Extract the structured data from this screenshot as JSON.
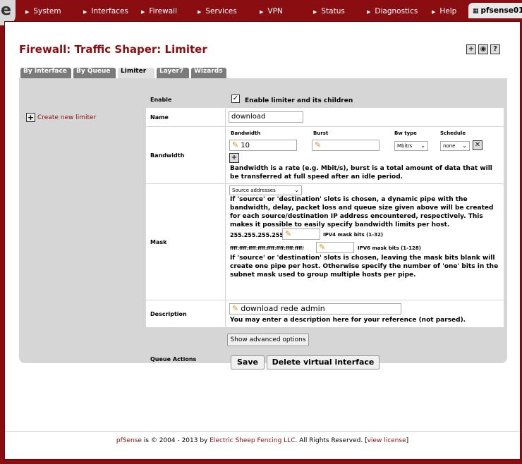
{
  "nav": {
    "logo": "e",
    "items": [
      "System",
      "Interfaces",
      "Firewall",
      "Services",
      "VPN",
      "Status",
      "Diagnostics",
      "Help"
    ],
    "hostname": "pfsense01"
  },
  "page": {
    "title": "Firewall: Traffic Shaper: Limiter",
    "tabs": [
      "By Interface",
      "By Queue",
      "Limiter",
      "Layer7",
      "Wizards"
    ],
    "active_tab": "Limiter",
    "create_link": "Create new limiter"
  },
  "form": {
    "enable": {
      "label": "Enable",
      "checkbox_label": "Enable limiter and its children",
      "checked": true
    },
    "name": {
      "label": "Name",
      "value": "download"
    },
    "bandwidth": {
      "label": "Bandwidth",
      "col_bandwidth": "Bandwidth",
      "col_burst": "Burst",
      "col_bwtype": "Bw type",
      "col_schedule": "Schedule",
      "bandwidth_value": "10",
      "burst_value": "",
      "bwtype_value": "Mbit/s",
      "schedule_value": "none",
      "help": "Bandwidth is a rate (e.g. Mbit/s), burst is a total amount of data that will be transferred at full speed after an idle period."
    },
    "mask": {
      "label": "Mask",
      "select_value": "Source addresses",
      "help1": "If 'source' or 'destination' slots is chosen, a dynamic pipe with the bandwidth, delay, packet loss and queue size given above will be created for each source/destination IP address encountered, respectively. This makes it possible to easily specify bandwidth limits per host.",
      "ipv4_prefix": "255.255.255.255/",
      "ipv4_label": "IPV4 mask bits (1-32)",
      "ipv6_prefix": "ffff:ffff:ffff:ffff:ffff:ffff:ffff:ffff/",
      "ipv6_label": "IPV6 mask bits (1-128)",
      "help2": "If 'source' or 'destination' slots is chosen, leaving the mask bits blank will create one pipe per host. Otherwise specify the number of 'one' bits in the subnet mask used to group multiple hosts per pipe."
    },
    "description": {
      "label": "Description",
      "value": "download rede admin",
      "help": "You may enter a description here for your reference (not parsed)."
    },
    "advanced_button": "Show advanced options",
    "queue_actions": {
      "label": "Queue Actions",
      "save": "Save",
      "delete": "Delete virtual interface"
    }
  },
  "footer": {
    "brand": "pfSense",
    "text1": " is © 2004 - 2013 by ",
    "company": "Electric Sheep Fencing LLC",
    "text2": ". All Rights Reserved. [",
    "license": "view license",
    "text3": "]"
  }
}
